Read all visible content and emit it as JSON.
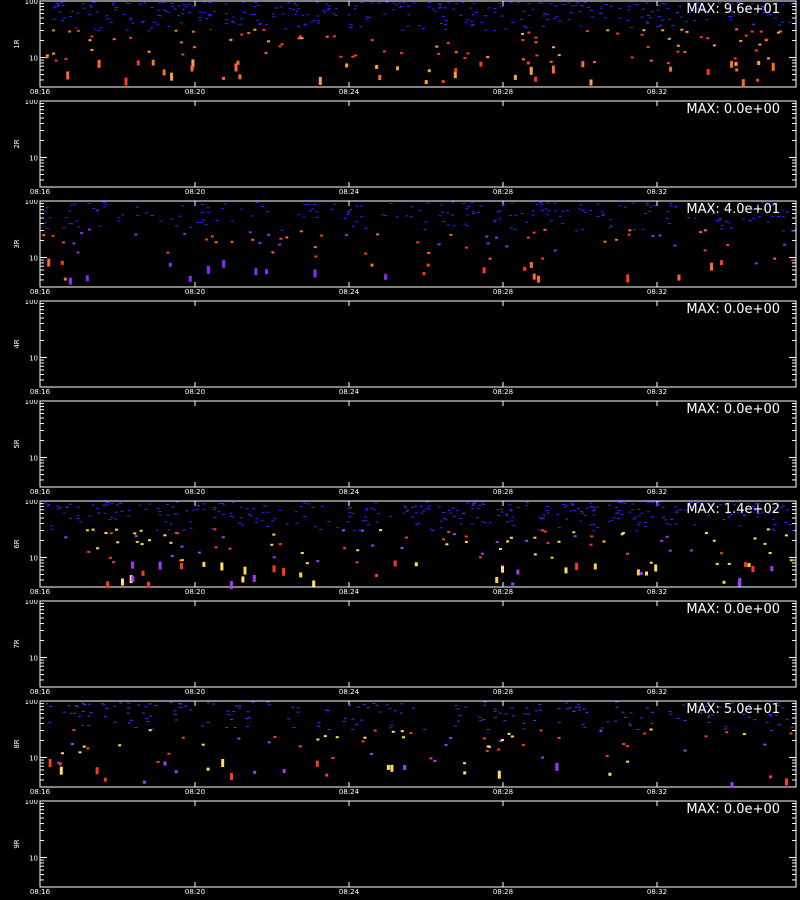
{
  "chart_data": [
    {
      "type": "heatmap",
      "panel_label": "1R",
      "max_label": "MAX: 9.6e+01",
      "max_value": 96,
      "y_scale": "log",
      "y_range": [
        3,
        100
      ],
      "y_tick_labels": [
        "10",
        "100"
      ],
      "x_tick_labels": [
        "08:16",
        "08:20",
        "08:24",
        "08:28",
        "08:32"
      ],
      "activity": "high",
      "colors": [
        "#2a2aff",
        "#ff6a2a",
        "#ff3a1a",
        "#ffa040"
      ]
    },
    {
      "type": "heatmap",
      "panel_label": "2R",
      "max_label": "MAX: 0.0e+00",
      "max_value": 0,
      "y_scale": "log",
      "y_range": [
        3,
        100
      ],
      "y_tick_labels": [
        "10",
        "100"
      ],
      "x_tick_labels": [
        "08:16",
        "08:20",
        "08:24",
        "08:28",
        "08:32"
      ],
      "activity": "none",
      "colors": []
    },
    {
      "type": "heatmap",
      "panel_label": "3R",
      "max_label": "MAX: 4.0e+01",
      "max_value": 40,
      "y_scale": "log",
      "y_range": [
        3,
        100
      ],
      "y_tick_labels": [
        "10",
        "100"
      ],
      "x_tick_labels": [
        "08:16",
        "08:20",
        "08:24",
        "08:28",
        "08:32"
      ],
      "activity": "medium",
      "colors": [
        "#2a2aff",
        "#ff6a2a",
        "#ff3a1a",
        "#8a2aff"
      ]
    },
    {
      "type": "heatmap",
      "panel_label": "4R",
      "max_label": "MAX: 0.0e+00",
      "max_value": 0,
      "y_scale": "log",
      "y_range": [
        3,
        100
      ],
      "y_tick_labels": [
        "10",
        "100"
      ],
      "x_tick_labels": [
        "08:16",
        "08:20",
        "08:24",
        "08:28",
        "08:32"
      ],
      "activity": "none",
      "colors": []
    },
    {
      "type": "heatmap",
      "panel_label": "5R",
      "max_label": "MAX: 0.0e+00",
      "max_value": 0,
      "y_scale": "log",
      "y_range": [
        3,
        100
      ],
      "y_tick_labels": [
        "10",
        "100"
      ],
      "x_tick_labels": [
        "08:16",
        "08:20",
        "08:24",
        "08:28",
        "08:32"
      ],
      "activity": "none",
      "colors": []
    },
    {
      "type": "heatmap",
      "panel_label": "6R",
      "max_label": "MAX: 1.4e+02",
      "max_value": 140,
      "y_scale": "log",
      "y_range": [
        3,
        100
      ],
      "y_tick_labels": [
        "10",
        "100"
      ],
      "x_tick_labels": [
        "08:16",
        "08:20",
        "08:24",
        "08:28",
        "08:32"
      ],
      "activity": "high",
      "colors": [
        "#2a2aff",
        "#ffe060",
        "#ff3a1a",
        "#a03aff",
        "#ffd040"
      ]
    },
    {
      "type": "heatmap",
      "panel_label": "7R",
      "max_label": "MAX: 0.0e+00",
      "max_value": 0,
      "y_scale": "log",
      "y_range": [
        3,
        100
      ],
      "y_tick_labels": [
        "10",
        "100"
      ],
      "x_tick_labels": [
        "08:16",
        "08:20",
        "08:24",
        "08:28",
        "08:32"
      ],
      "activity": "none",
      "colors": []
    },
    {
      "type": "heatmap",
      "panel_label": "8R",
      "max_label": "MAX: 5.0e+01",
      "max_value": 50,
      "y_scale": "log",
      "y_range": [
        3,
        100
      ],
      "y_tick_labels": [
        "10",
        "100"
      ],
      "x_tick_labels": [
        "08:16",
        "08:20",
        "08:24",
        "08:28",
        "08:32"
      ],
      "activity": "medium",
      "colors": [
        "#5a2aff",
        "#ffe060",
        "#ff3a1a",
        "#a03aff"
      ]
    },
    {
      "type": "heatmap",
      "panel_label": "9R",
      "max_label": "MAX: 0.0e+00",
      "max_value": 0,
      "y_scale": "log",
      "y_range": [
        3,
        100
      ],
      "y_tick_labels": [
        "10",
        "100"
      ],
      "x_tick_labels": [
        "08:16",
        "08:20",
        "08:24",
        "08:28",
        "08:32"
      ],
      "activity": "none",
      "colors": []
    }
  ],
  "footer_text": ""
}
